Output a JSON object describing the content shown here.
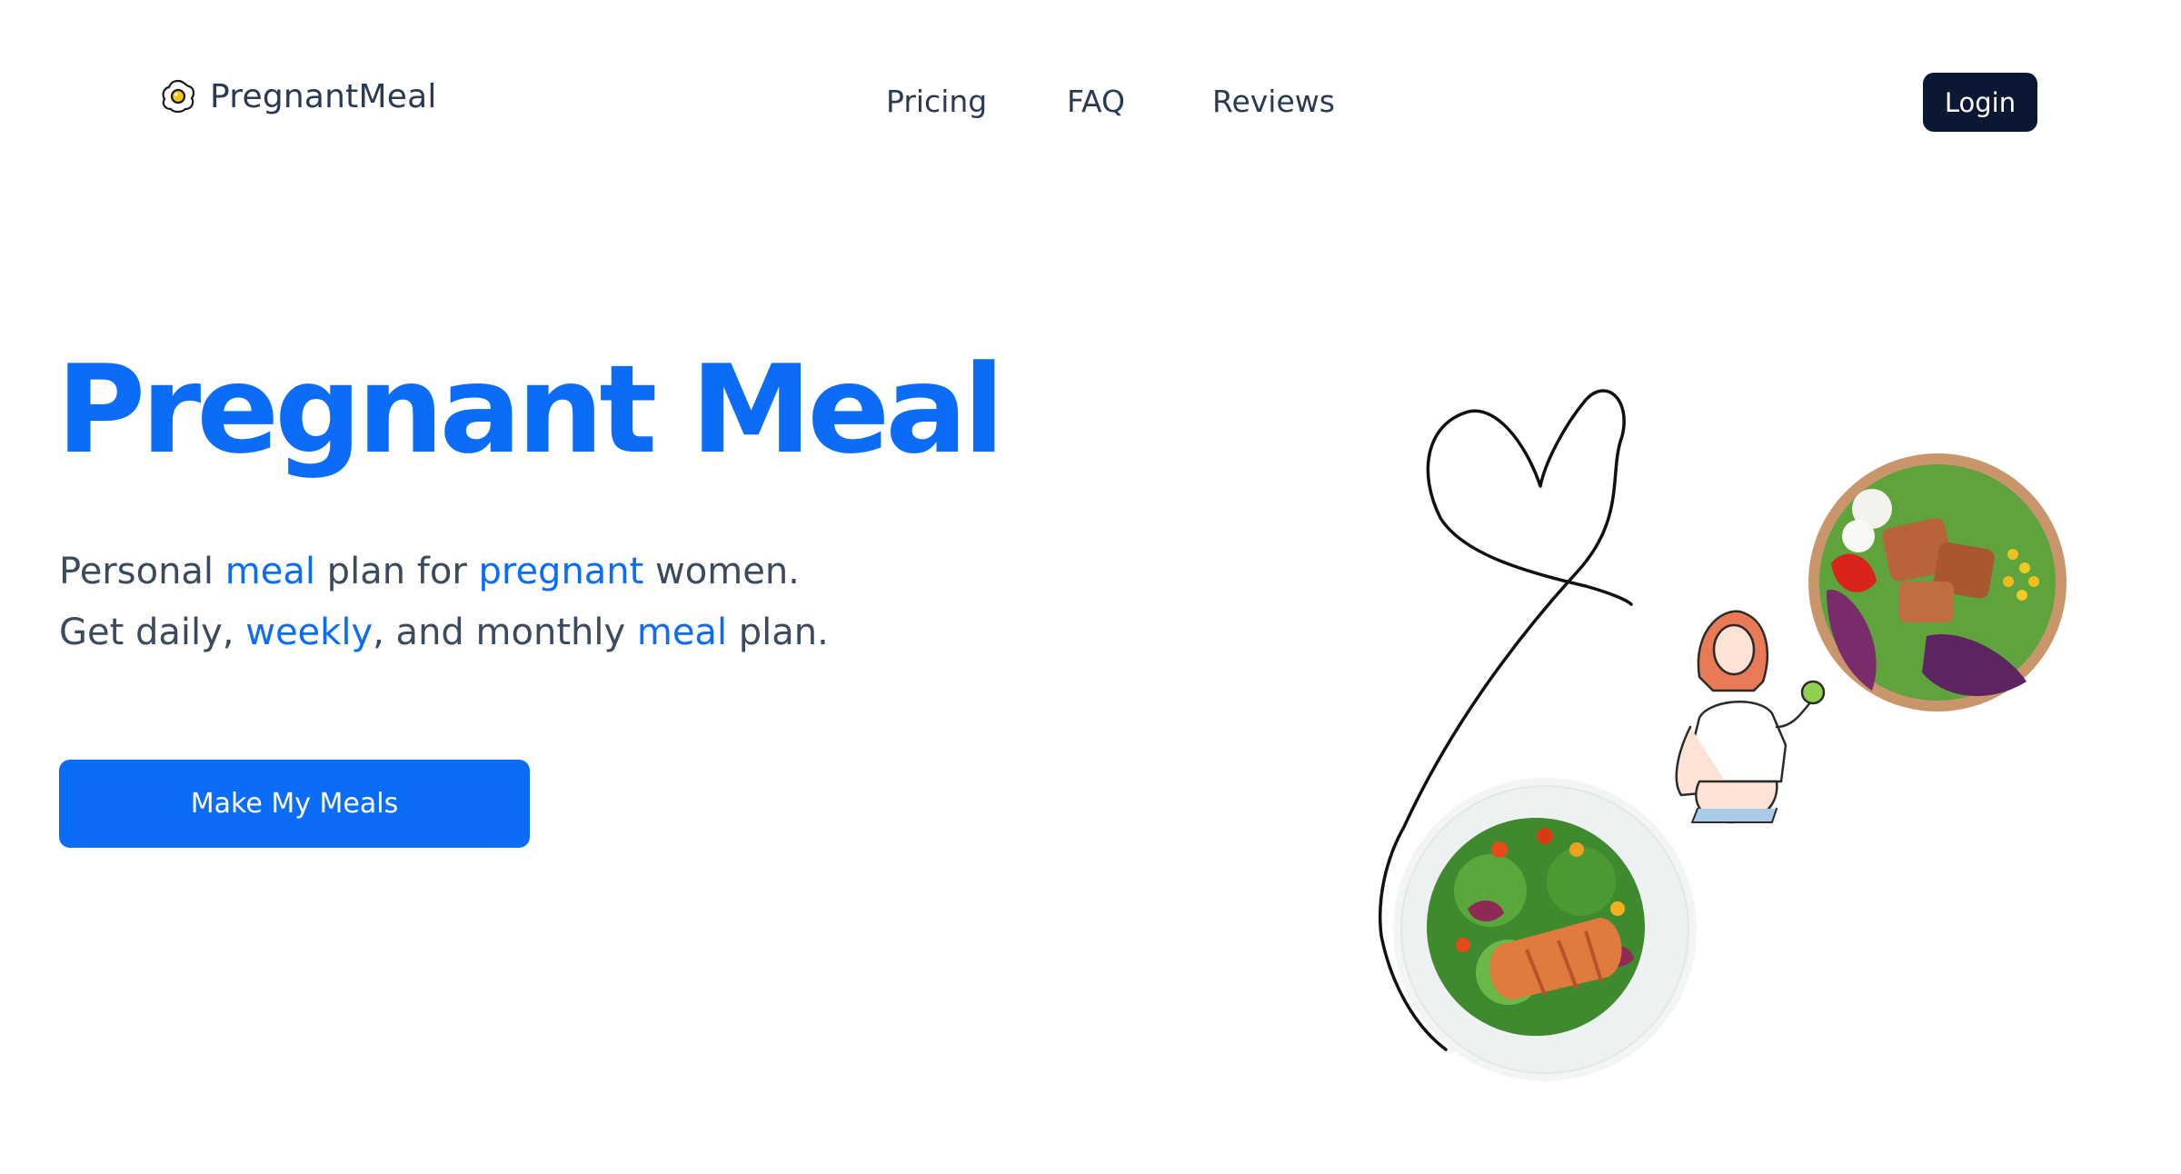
{
  "header": {
    "brand": "PregnantMeal",
    "nav": [
      {
        "label": "Pricing"
      },
      {
        "label": "FAQ"
      },
      {
        "label": "Reviews"
      }
    ],
    "login_label": "Login"
  },
  "hero": {
    "title": "Pregnant Meal",
    "line1": {
      "p1": "Personal ",
      "h1": "meal",
      "p2": " plan for ",
      "h2": "pregnant",
      "p3": " women."
    },
    "line2": {
      "p1": "Get daily, ",
      "h1": "weekly",
      "p2": ", and monthly ",
      "h2": "meal",
      "p3": " plan."
    },
    "cta_label": "Make My Meals"
  },
  "colors": {
    "accent": "#0b6cf7",
    "dark": "#0b1833",
    "text": "#3c4a5e"
  },
  "icons": {
    "logo": "fried-egg-icon"
  },
  "illustration": {
    "items": [
      "heart-line-drawing",
      "salad-bowl-image",
      "pregnant-woman-illustration",
      "salmon-salad-plate-image"
    ]
  }
}
